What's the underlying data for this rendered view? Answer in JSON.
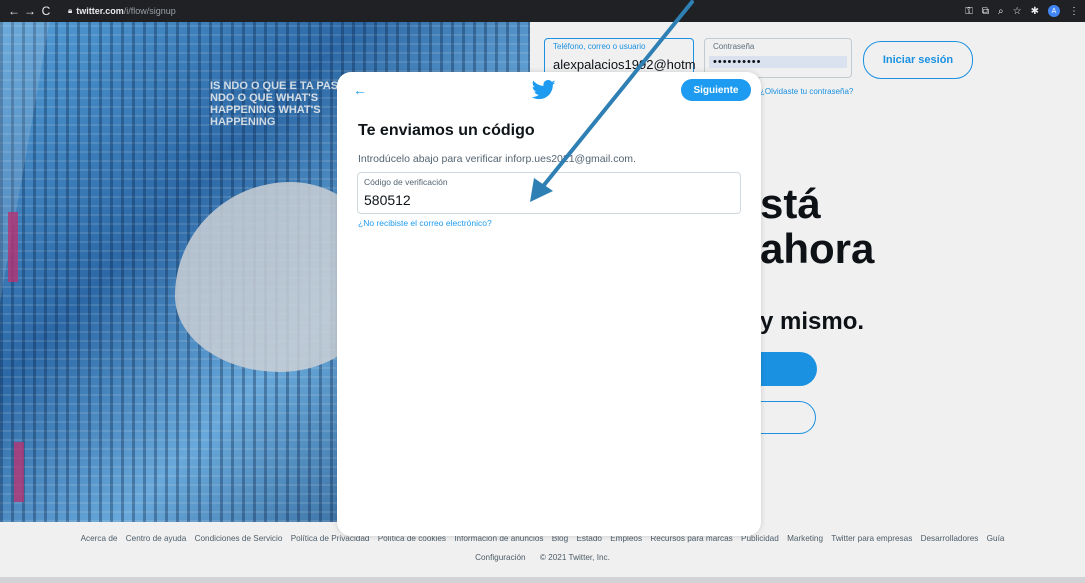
{
  "browser": {
    "url_host": "twitter.com",
    "url_path": "/i/flow/signup",
    "back_icon": "back-arrow-icon",
    "forward_icon": "forward-arrow-icon",
    "reload_icon": "reload-icon",
    "lock_icon": "lock-icon",
    "profile_initial": "A"
  },
  "login_bar": {
    "user_label": "Teléfono, correo o usuario",
    "user_value": "alexpalacios1992@hotm",
    "pass_label": "Contraseña",
    "pass_value": "••••••••••",
    "login_button": "Iniciar sesión",
    "forgot": "¿Olvidaste tu contraseña?"
  },
  "background_page": {
    "art_text": "IS NDO O QUE E TA PAS NDO O QUE WHAT'S HAPPENING WHAT'S HAPPENING",
    "headline_line1": "stá",
    "headline_line2": "ahora",
    "subheadline": "y mismo."
  },
  "modal": {
    "back_label": "←",
    "next_button": "Siguiente",
    "title": "Te enviamos un código",
    "description": "Introdúcelo abajo para verificar inforp.ues2021@gmail.com.",
    "code_label": "Código de verificación",
    "code_value": "580512",
    "resend_link": "¿No recibiste el correo electrónico?"
  },
  "footer": {
    "links": [
      "Acerca de",
      "Centro de ayuda",
      "Condiciones de Servicio",
      "Política de Privacidad",
      "Política de cookies",
      "Información de anuncios",
      "Blog",
      "Estado",
      "Empleos",
      "Recursos para marcas",
      "Publicidad",
      "Marketing",
      "Twitter para empresas",
      "Desarrolladores",
      "Guía"
    ],
    "settings": "Configuración",
    "copyright": "© 2021 Twitter, Inc."
  },
  "colors": {
    "accent": "#1d9bf0",
    "arrow": "#2e7fb3"
  }
}
